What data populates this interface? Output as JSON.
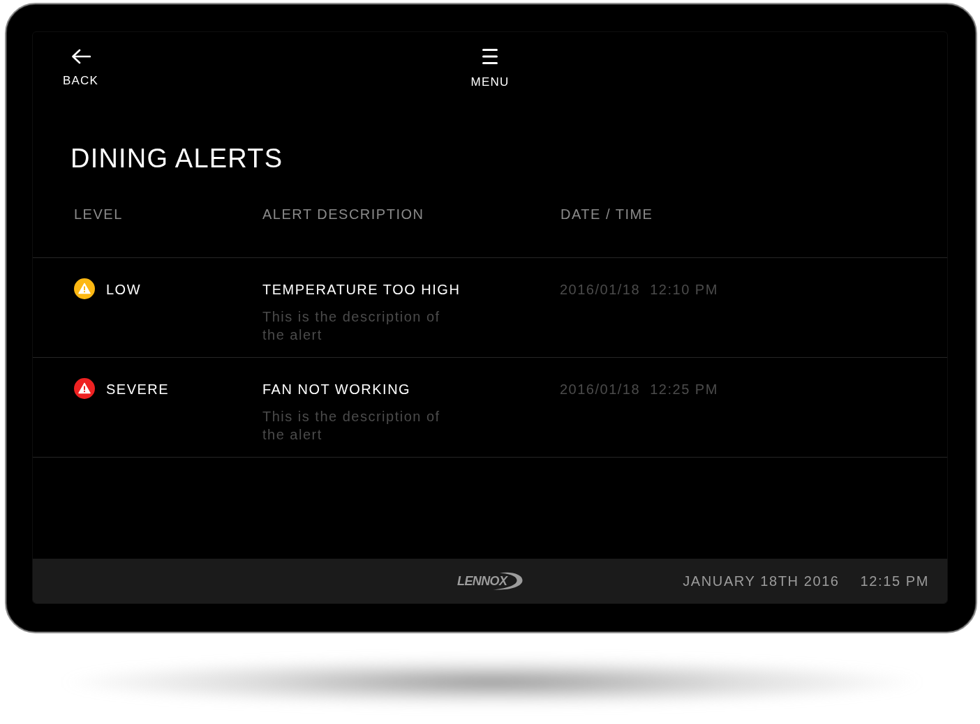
{
  "header": {
    "back_label": "BACK",
    "menu_label": "MENU"
  },
  "title": "DINING ALERTS",
  "table": {
    "columns": [
      "LEVEL",
      "ALERT DESCRIPTION",
      "DATE / TIME"
    ],
    "rows": [
      {
        "level": "LOW",
        "color": "#fdb813",
        "title": "TEMPERATURE TOO HIGH",
        "description": "This is the description of the alert",
        "datetime": "2016/01/18  12:10 PM"
      },
      {
        "level": "SEVERE",
        "color": "#ee2222",
        "title": "FAN NOT WORKING",
        "description": "This is the description of the alert",
        "datetime": "2016/01/18  12:25 PM"
      }
    ]
  },
  "footer": {
    "logo": "LENNOX",
    "date": "JANUARY 18TH 2016",
    "time": "12:15 PM"
  }
}
